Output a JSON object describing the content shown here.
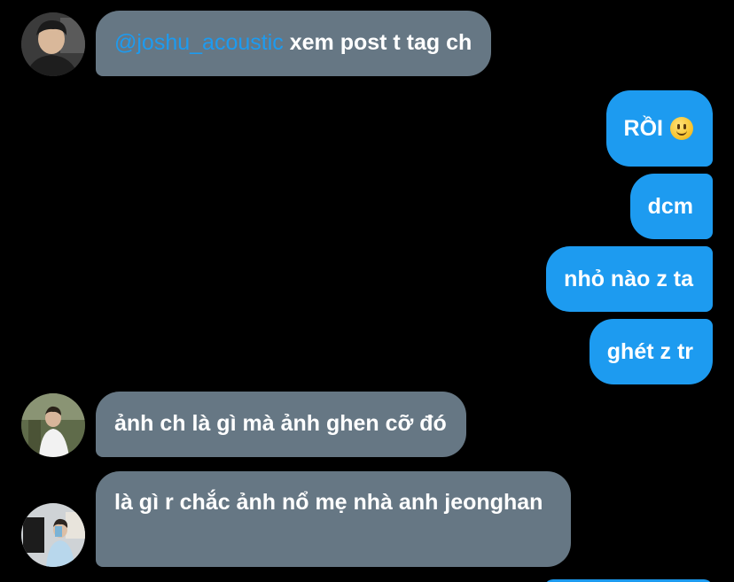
{
  "conversation": {
    "messages": [
      {
        "sender": "other",
        "mention": "@joshu_acoustic",
        "text": " xem post t tag ch"
      },
      {
        "sender": "me",
        "text": "RỒI",
        "emoji": "slightly-smiling-face"
      },
      {
        "sender": "me",
        "text": "dcm"
      },
      {
        "sender": "me",
        "text": "nhỏ nào z ta"
      },
      {
        "sender": "me",
        "text": "ghét z tr"
      },
      {
        "sender": "other",
        "text": "ảnh ch là gì mà ảnh ghen cỡ đó"
      },
      {
        "sender": "other",
        "text": "là gì r chắc ảnh nổ mẹ nhà anh jeonghan"
      }
    ]
  },
  "colors": {
    "background": "#000000",
    "incoming_bubble": "#667784",
    "outgoing_bubble": "#1d9bf0",
    "mention": "#1d9bf0",
    "text": "#ffffff"
  },
  "icons": {
    "avatar_1": "profile-avatar-icon",
    "avatar_2": "profile-avatar-icon",
    "avatar_3": "profile-avatar-icon"
  }
}
